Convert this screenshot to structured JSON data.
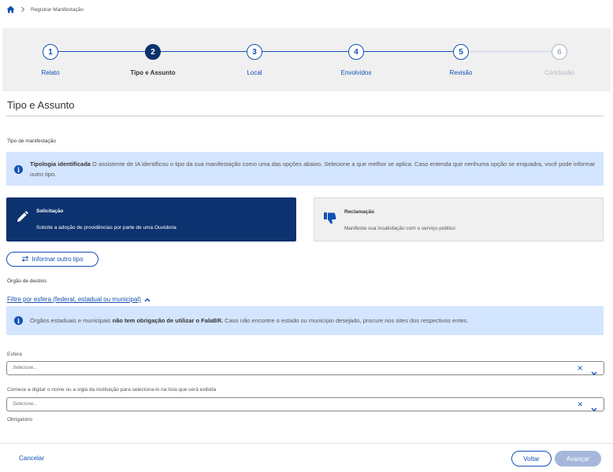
{
  "breadcrumb": {
    "home_icon": "home-icon",
    "current": "Registrar Manifestação"
  },
  "stepper": {
    "steps": [
      {
        "number": "1",
        "label": "Relato",
        "state": "done"
      },
      {
        "number": "2",
        "label": "Tipo e Assunto",
        "state": "active"
      },
      {
        "number": "3",
        "label": "Local",
        "state": "pending"
      },
      {
        "number": "4",
        "label": "Envolvidos",
        "state": "pending"
      },
      {
        "number": "5",
        "label": "Revisão",
        "state": "pending"
      },
      {
        "number": "6",
        "label": "Conclusão",
        "state": "disabled"
      }
    ]
  },
  "page_title": "Tipo e Assunto",
  "tipo": {
    "section_label": "Tipo de manifestação",
    "ai_alert": {
      "title": "Tipologia identificada",
      "text": " O assistente de IA identificou o tipo da sua manifestação como uma das opções abaixo. Selecione a que melhor se aplica. Caso entenda que nenhuma opção se enquadra, você pode informar outro tipo."
    },
    "cards": [
      {
        "title": "Solicitação",
        "description": "Solicite a adoção de providências por parte de uma Ouvidoria",
        "icon": "pencil-icon",
        "selected": true
      },
      {
        "title": "Reclamação",
        "description": "Manifeste sua insatisfação com o serviço público",
        "icon": "thumbs-down-icon",
        "selected": false
      }
    ],
    "other_button": "Informar outro tipo"
  },
  "orgao": {
    "section_label": "Órgão de destino",
    "filter_link": "Filtre por esfera (federal, estadual ou municipal)",
    "alert": {
      "prefix": "Órgãos estaduais e municipais ",
      "bold": "não tem obrigação de utilizar o FalaBR.",
      "suffix": " Caso não encontre o estado ou município desejado, procure nos sites dos respectivos entes."
    },
    "esfera_label": "Esfera",
    "esfera_placeholder": "Selecione...",
    "instituicao_label": "Comece a digitar o nome ou a sigla da instituição para seleciona-lo na lista que será exibida",
    "instituicao_placeholder": "Selecione...",
    "required_text": "Obrigatório"
  },
  "footer": {
    "cancel": "Cancelar",
    "back": "Voltar",
    "next": "Avançar"
  },
  "colors": {
    "primary": "#1351b4",
    "dark_primary": "#0c326f",
    "info_bg": "#d4e5ff",
    "disabled_button": "#a5b8db"
  }
}
